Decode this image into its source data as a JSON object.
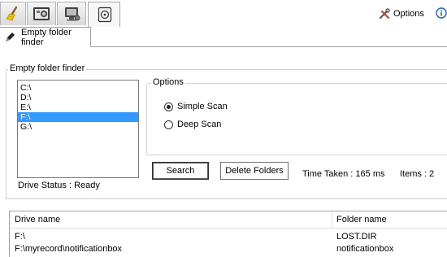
{
  "top_tabs": [
    {
      "name": "cleaner-tab",
      "icon": "broom-icon",
      "active": false
    },
    {
      "name": "media-tab",
      "icon": "film-icon",
      "active": false
    },
    {
      "name": "system-tab",
      "icon": "monitor-icon",
      "active": false
    },
    {
      "name": "disk-tab",
      "icon": "disk-icon",
      "active": true
    }
  ],
  "toolbar": {
    "options_label": "Options",
    "options_icon": "tools-icon",
    "info_icon": "info-icon"
  },
  "subtab": {
    "label": "Empty folder finder",
    "icon": "pencil-icon"
  },
  "finder": {
    "group_title": "Empty folder finder",
    "drives": [
      "C:\\",
      "D:\\",
      "E:\\",
      "F:\\",
      "G:\\"
    ],
    "selected_drive": "F:\\",
    "options_title": "Options",
    "scan_options": [
      {
        "label": "Simple Scan",
        "selected": true
      },
      {
        "label": "Deep Scan",
        "selected": false
      }
    ],
    "search_label": "Search",
    "delete_label": "Delete Folders",
    "time_taken": "Time Taken : 165 ms",
    "items": "Items : 2",
    "drive_status": "Drive Status : Ready"
  },
  "results": {
    "columns": [
      "Drive name",
      "Folder name"
    ],
    "rows": [
      {
        "drive": "F:\\",
        "folder": "LOST.DIR"
      },
      {
        "drive": "F:\\myrecord\\notificationbox",
        "folder": "notificationbox"
      }
    ]
  },
  "colors": {
    "selection": "#3399ff",
    "border": "#a0a0a0"
  }
}
